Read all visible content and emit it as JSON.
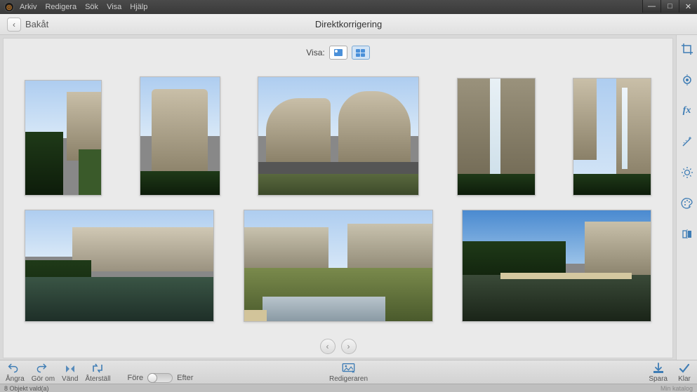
{
  "menubar": {
    "items": [
      "Arkiv",
      "Redigera",
      "Sök",
      "Visa",
      "Hjälp"
    ]
  },
  "header": {
    "back_label": "Bakåt",
    "title": "Direktkorrigering"
  },
  "viewbar": {
    "label": "Visa:"
  },
  "pager": {
    "prev": "‹",
    "next": "›"
  },
  "right_tools": {
    "crop": "crop",
    "redeye": "redeye",
    "fx": "fx",
    "wand": "wand",
    "brightness": "brightness",
    "color": "color",
    "flip": "flip"
  },
  "bottom": {
    "undo": "Ångra",
    "redo": "Gör om",
    "flip": "Vänd",
    "reset": "Återställ",
    "before": "Före",
    "after": "Efter",
    "editor": "Redigeraren",
    "save": "Spara",
    "done": "Klar"
  },
  "status": {
    "left": "8 Objekt vald(a)",
    "right": "Min katalog"
  }
}
